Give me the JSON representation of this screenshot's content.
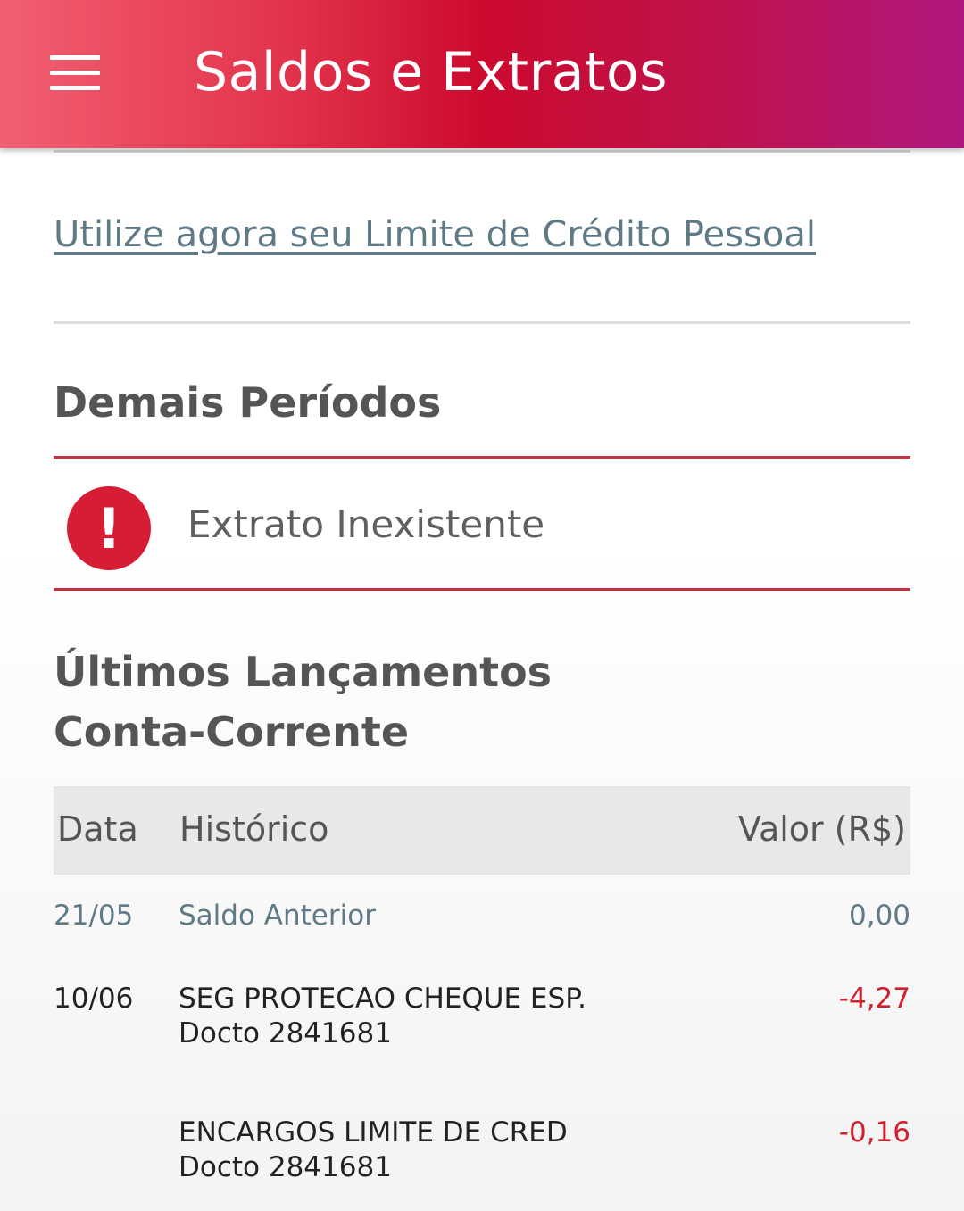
{
  "header": {
    "title": "Saldos e Extratos",
    "menu_icon": "hamburger-menu-icon"
  },
  "credit_link": "Utilize agora seu Limite de Crédito Pessoal",
  "other_periods": {
    "title": "Demais Períodos",
    "alert_icon": "exclamation-icon",
    "alert_symbol": "!",
    "alert_text": "Extrato Inexistente"
  },
  "latest": {
    "title_line1": "Últimos Lançamentos",
    "title_line2": "Conta-Corrente"
  },
  "table": {
    "headers": [
      "Data",
      "Histórico",
      "Valor (R$)"
    ],
    "rows": [
      {
        "date": "21/05",
        "description": "Saldo Anterior",
        "detail": "",
        "value": "0,00"
      },
      {
        "date": "10/06",
        "description": "SEG PROTECAO CHEQUE ESP.",
        "detail": "Docto 2841681",
        "value": "-4,27"
      },
      {
        "date": "",
        "description": "ENCARGOS LIMITE DE CRED",
        "detail": "Docto 2841681",
        "value": "-0,16"
      }
    ]
  },
  "colors": {
    "brand_red": "#cc0a2f",
    "brand_magenta": "#b1177f",
    "negative_value": "#d0202e",
    "link": "#5f7a86"
  }
}
